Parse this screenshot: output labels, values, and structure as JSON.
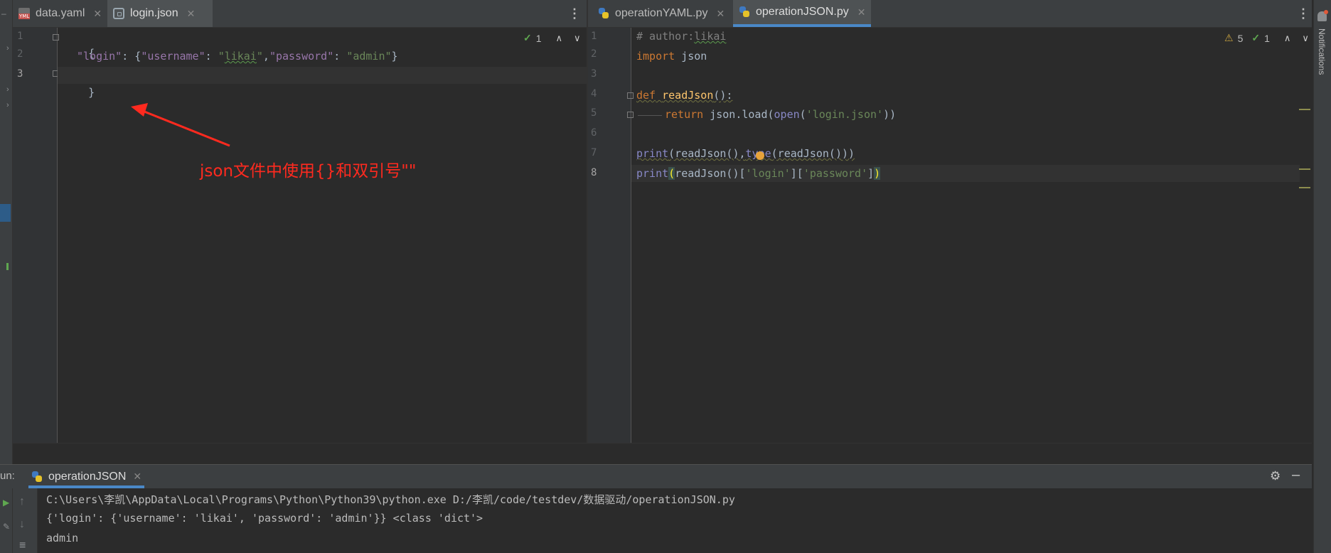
{
  "left_editor": {
    "tabs": [
      {
        "label": "data.yaml",
        "icon": "yaml-file-icon"
      },
      {
        "label": "login.json",
        "icon": "json-file-icon",
        "active": true
      }
    ],
    "line_numbers": [
      "1",
      "2",
      "3"
    ],
    "code": {
      "l1": "{",
      "l2_key": "\"login\"",
      "l2_colon": ": {",
      "l2_k1": "\"username\"",
      "l2_c1": ": ",
      "l2_v1a": "\"",
      "l2_v1b": "likai",
      "l2_v1c": "\"",
      "l2_sep": ",",
      "l2_k2": "\"password\"",
      "l2_c2": ": ",
      "l2_v2": "\"admin\"",
      "l2_end": "}",
      "l3": "}"
    },
    "inspection_count": "1",
    "annotation": "json文件中使用{}和双引号\"\""
  },
  "right_editor": {
    "tabs": [
      {
        "label": "operationYAML.py",
        "icon": "python-file-icon"
      },
      {
        "label": "operationJSON.py",
        "icon": "python-file-icon",
        "active": true
      }
    ],
    "line_numbers": [
      "1",
      "2",
      "3",
      "4",
      "5",
      "6",
      "7",
      "8"
    ],
    "code": {
      "l1_a": "# author:",
      "l1_b": "likai",
      "l2_kw": "import",
      "l2_mod": " json",
      "l4_kw": "def",
      "l4_sp": " ",
      "l4_fn": "readJson",
      "l4_rest": "():",
      "l5_kw": "return",
      "l5_a": " json.load(",
      "l5_open": "open",
      "l5_b": "(",
      "l5_str": "'login.json'",
      "l5_c": "))",
      "l7_print": "print",
      "l7_a": "(readJson(),",
      "l7_type": "type",
      "l7_b": "(readJson()))",
      "l8_print": "print",
      "l8_open": "(",
      "l8_a": "readJson()[",
      "l8_s1": "'login'",
      "l8_b": "][",
      "l8_s2": "'password'",
      "l8_c": "]",
      "l8_close": ")"
    },
    "warning_count": "5",
    "inspection_count": "1"
  },
  "notifications_label": "Notifications",
  "run_panel": {
    "label": "un:",
    "tab_label": "operationJSON",
    "console_lines": [
      "C:\\Users\\李凯\\AppData\\Local\\Programs\\Python\\Python39\\python.exe D:/李凯/code/testdev/数据驱动/operationJSON.py",
      "{'login': {'username': 'likai', 'password': 'admin'}} <class 'dict'>",
      "admin"
    ]
  },
  "colors": {
    "annotation": "#ff2a1f",
    "active_tab_underline": "#4a88c7"
  }
}
